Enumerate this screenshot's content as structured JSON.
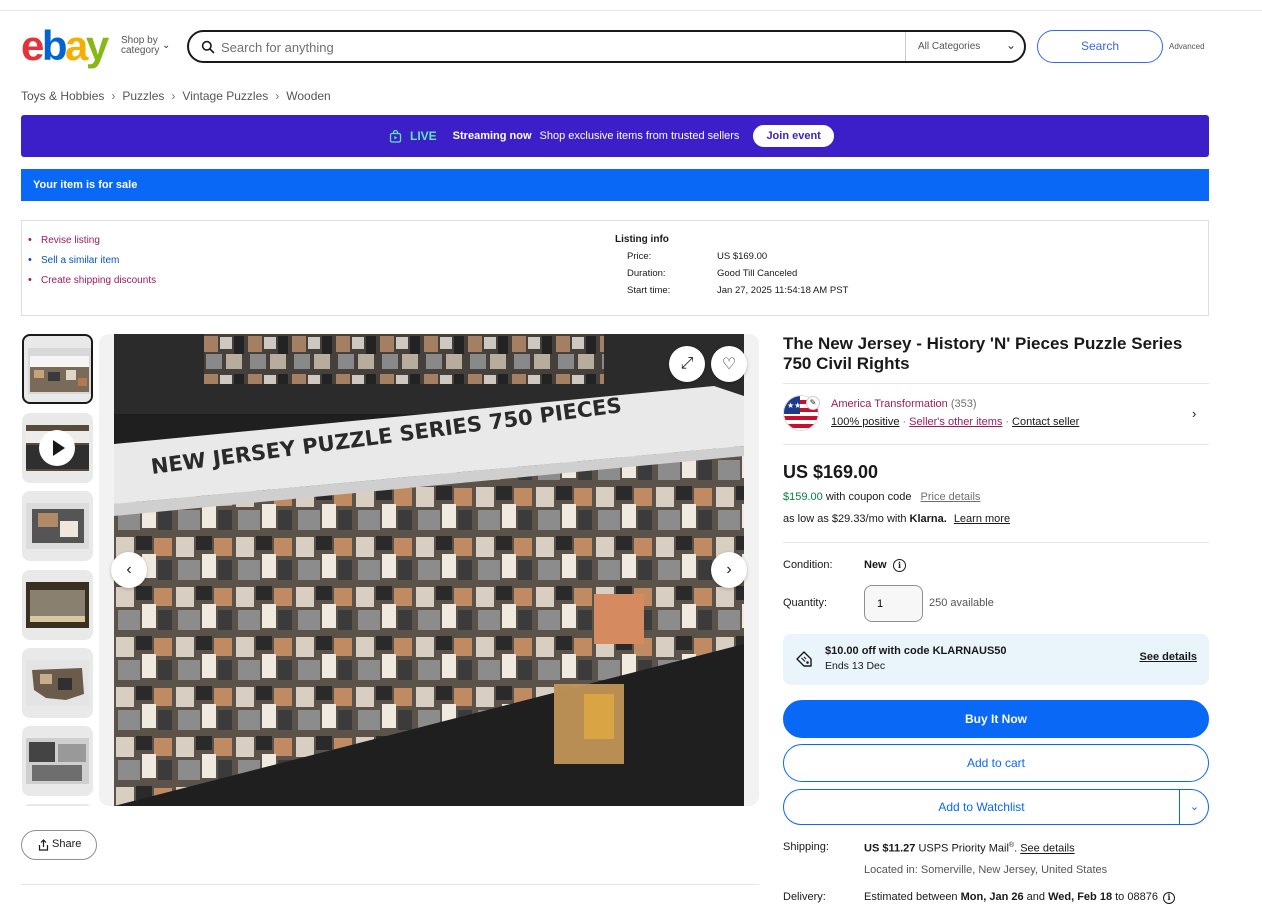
{
  "header": {
    "logo": {
      "e": "e",
      "b": "b",
      "a": "a",
      "y": "y"
    },
    "shop_by_line1": "Shop by",
    "shop_by_line2": "category",
    "search_placeholder": "Search for anything",
    "category": "All Categories",
    "search_button": "Search",
    "advanced": "Advanced"
  },
  "breadcrumb": [
    "Toys & Hobbies",
    "Puzzles",
    "Vintage Puzzles",
    "Wooden"
  ],
  "live_banner": {
    "tag": "LIVE",
    "streaming": "Streaming now",
    "text": "Shop exclusive items from trusted sellers",
    "button": "Join event"
  },
  "sale_banner": "Your item is for sale",
  "seller_tools": {
    "revise": "Revise listing",
    "similar": "Sell a similar item",
    "discounts": "Create shipping discounts"
  },
  "listing_info": {
    "title": "Listing info",
    "price_label": "Price:",
    "price_value": "US $169.00",
    "duration_label": "Duration:",
    "duration_value": "Good Till Canceled",
    "start_label": "Start time:",
    "start_value": "Jan 27, 2025 11:54:18 AM PST"
  },
  "gallery": {
    "main_image_text": "NEW JERSEY PUZZLE SERIES 750 PIECES"
  },
  "share": "Share",
  "item": {
    "title": "The New Jersey - History 'N' Pieces Puzzle Series 750 Civil Rights",
    "seller_name": "America Transformation",
    "seller_count": "(353)",
    "positive": "100% positive",
    "other_items": "Seller's other items",
    "contact": "Contact seller",
    "price": "US $169.00",
    "coupon_price": "$159.00",
    "coupon_text": "with coupon code",
    "price_details": "Price details",
    "klarna_prefix": "as low as $29.33/mo with",
    "klarna_brand": "Klarna.",
    "learn_more": "Learn more",
    "condition_label": "Condition:",
    "condition_value": "New",
    "quantity_label": "Quantity:",
    "quantity_value": "1",
    "available": "250 available",
    "promo_title": "$10.00 off with code KLARNAUS50",
    "promo_ends": "Ends 13 Dec",
    "promo_link": "See details",
    "buy_now": "Buy It Now",
    "add_to_cart": "Add to cart",
    "watchlist": "Add to Watchlist",
    "shipping_label": "Shipping:",
    "shipping_price": "US $11.27",
    "shipping_service": "USPS Priority Mail",
    "shipping_reg": "®",
    "shipping_details": "See details",
    "location": "Located in: Somerville, New Jersey, United States",
    "delivery_label": "Delivery:",
    "delivery_prefix": "Estimated between",
    "delivery_from": "Mon, Jan 26",
    "delivery_and": "and",
    "delivery_to": "Wed, Feb 18",
    "delivery_zip": "to 08876"
  },
  "colors": {
    "accent": "#0968f6",
    "live_bg": "#3c1fc8",
    "live_green": "#5ee8b5",
    "seller_pink": "#9b1c5e",
    "coupon_green": "#05823f",
    "promo_bg": "#eaf4fb"
  },
  "icons": [
    "search-icon",
    "chevron-down-icon",
    "live-bag-icon",
    "play-icon",
    "expand-icon",
    "heart-icon",
    "chevron-left-icon",
    "chevron-right-icon",
    "share-icon",
    "pencil-icon",
    "info-icon",
    "tag-icon"
  ]
}
